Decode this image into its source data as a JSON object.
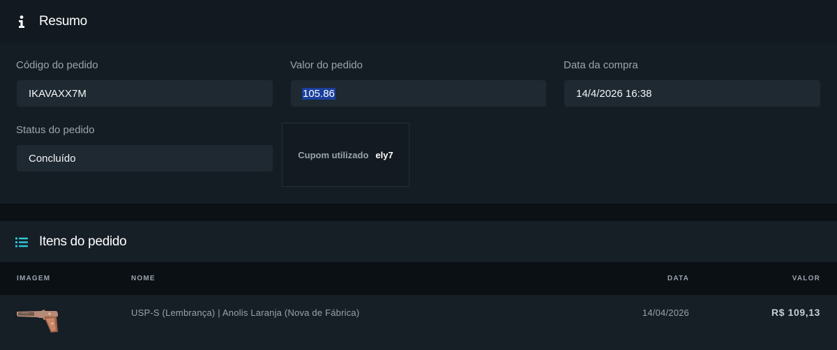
{
  "summary": {
    "title": "Resumo",
    "icon": "info-icon",
    "fields": {
      "order_code": {
        "label": "Código do pedido",
        "value": "IKAVAXX7M"
      },
      "order_value": {
        "label": "Valor do pedido",
        "value": "105.86"
      },
      "purchase_date": {
        "label": "Data da compra",
        "value": "14/4/2026 16:38"
      },
      "order_status": {
        "label": "Status do pedido",
        "value": "Concluído"
      }
    },
    "coupon": {
      "label": "Cupom utilizado",
      "value": "ely7"
    }
  },
  "items": {
    "title": "Itens do pedido",
    "icon": "list-icon",
    "accent": "#2fc7d8",
    "columns": {
      "image": "IMAGEM",
      "name": "NOME",
      "date": "DATA",
      "value": "VALOR"
    },
    "rows": [
      {
        "image_icon": "pistol-skin-icon",
        "name": "USP-S (Lembrança) | Anolis Laranja (Nova de Fábrica)",
        "date": "14/04/2026",
        "value": "R$ 109,13"
      }
    ]
  }
}
